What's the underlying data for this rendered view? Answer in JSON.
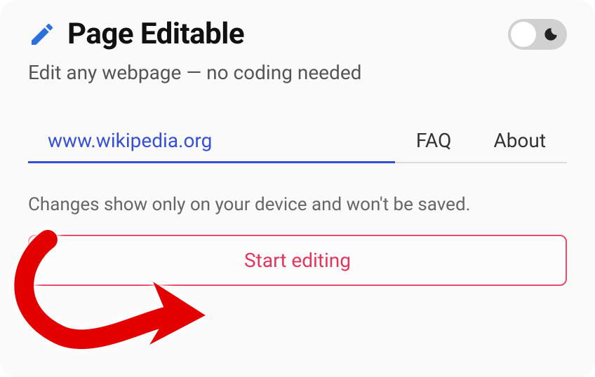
{
  "header": {
    "title": "Page Editable"
  },
  "subtitle": "Edit any webpage — no coding needed",
  "tabs": {
    "main": "www.wikipedia.org",
    "faq": "FAQ",
    "about": "About"
  },
  "info": "Changes show only on your device and won't be saved.",
  "button": {
    "start": "Start editing"
  },
  "colors": {
    "accent_blue": "#3550d6",
    "accent_red": "#e2365c",
    "icon_blue": "#2b71de"
  }
}
